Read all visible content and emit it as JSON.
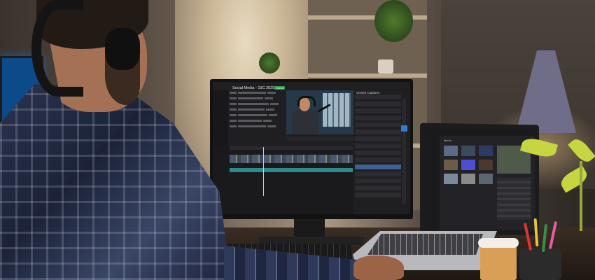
{
  "scene": {
    "subject": "man with headphones editing video at desk",
    "colors": {
      "wall_warm": "#a8977f",
      "monitor_ui_bg": "#1f1f22",
      "accent_blue": "#2f7bd6",
      "accent_green": "#2e9b4a",
      "audio_track": "#2f8a8a",
      "lamp": "#6f6d88",
      "plant_leaf": "#c6d640"
    }
  },
  "monitor": {
    "project_title": "Social Media - 10C 2025",
    "status_badge": "Saved",
    "right_panel_title": "Closed Captions"
  },
  "laptop": {
    "panel_title": "Media"
  }
}
